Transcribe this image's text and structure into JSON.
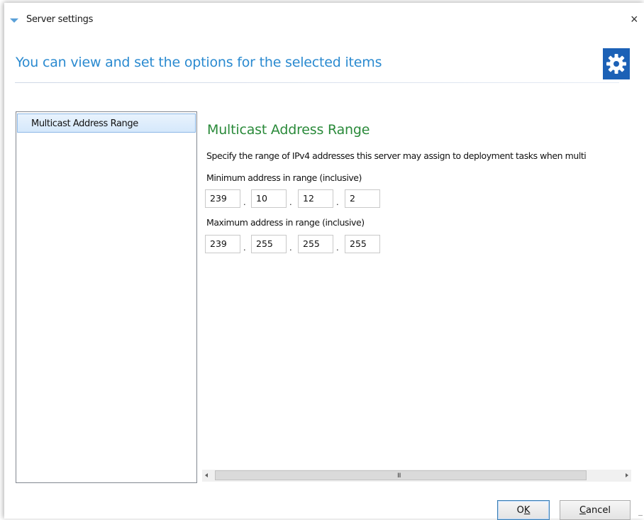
{
  "window": {
    "title": "Server settings",
    "close_glyph": "×"
  },
  "header": {
    "text": "You can view and set the options for the selected items",
    "icon": "gear-icon",
    "icon_bg": "#1c61b6"
  },
  "nav": {
    "items": [
      {
        "label": "Multicast Address Range",
        "selected": true
      }
    ]
  },
  "section": {
    "title": "Multicast Address Range",
    "description": "Specify the range of IPv4 addresses this server may assign to deployment tasks when multi",
    "min_label": "Minimum address in range (inclusive)",
    "min_octets": [
      "239",
      "10",
      "12",
      "2"
    ],
    "max_label": "Maximum address in range (inclusive)",
    "max_octets": [
      "239",
      "255",
      "255",
      "255"
    ],
    "separator": "."
  },
  "scrollbar": {
    "grip": "III"
  },
  "buttons": {
    "ok_prefix": "O",
    "ok_accel": "K",
    "cancel_accel": "C",
    "cancel_suffix": "ancel"
  },
  "colors": {
    "header_text": "#2a8ad0",
    "section_title": "#2a8a3a",
    "selection": "#d5e8fb"
  }
}
